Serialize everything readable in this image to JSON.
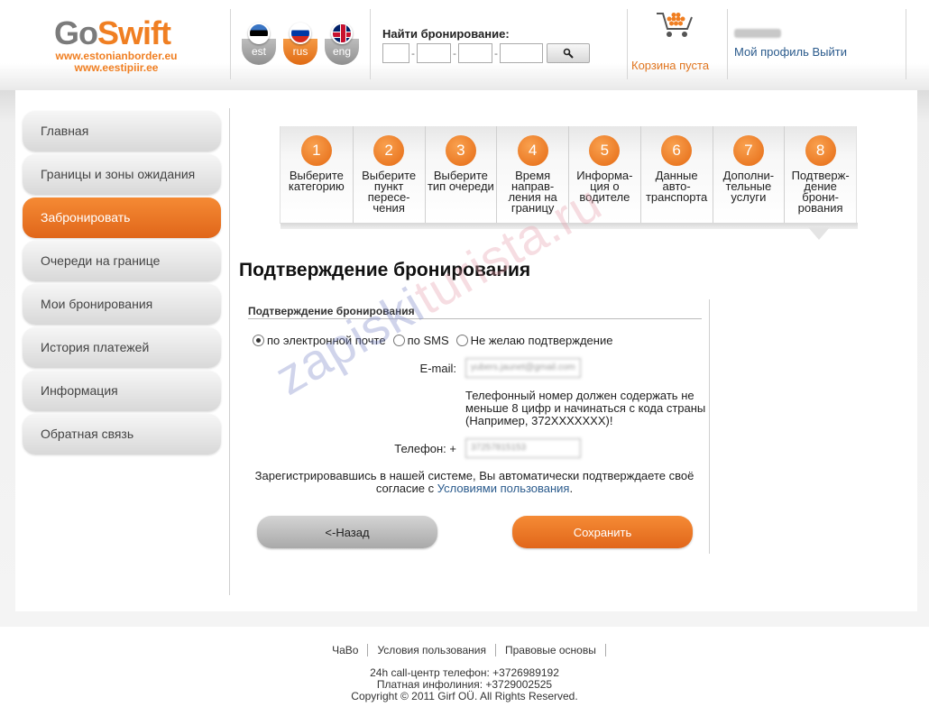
{
  "header": {
    "logo": {
      "part1": "Go",
      "part2": "Swift",
      "url1": "www.estonianborder.eu",
      "url2": "www.eestipiir.ee"
    },
    "languages": [
      {
        "code": "est",
        "active": false
      },
      {
        "code": "rus",
        "active": true
      },
      {
        "code": "eng",
        "active": false
      }
    ],
    "find_label": "Найти бронирование:",
    "find_separator": "-",
    "cart_text": "Корзина пуста",
    "profile_links": "Мой профиль Выйти"
  },
  "sidebar": {
    "items": [
      {
        "label": "Главная",
        "active": false
      },
      {
        "label": "Границы и зоны ожидания",
        "active": false
      },
      {
        "label": "Забронировать",
        "active": true
      },
      {
        "label": "Очереди на границе",
        "active": false
      },
      {
        "label": "Мои бронирования",
        "active": false
      },
      {
        "label": "История платежей",
        "active": false
      },
      {
        "label": "Информация",
        "active": false
      },
      {
        "label": "Обратная связь",
        "active": false
      }
    ]
  },
  "steps": [
    {
      "num": "1",
      "label": "Выберите категорию"
    },
    {
      "num": "2",
      "label": "Выберите пункт пересе-чения"
    },
    {
      "num": "3",
      "label": "Выберите тип очереди"
    },
    {
      "num": "4",
      "label": "Время направ-ления на границу"
    },
    {
      "num": "5",
      "label": "Информа-ция о водителе"
    },
    {
      "num": "6",
      "label": "Данные авто-транспорта"
    },
    {
      "num": "7",
      "label": "Дополни-тельные услуги"
    },
    {
      "num": "8",
      "label": "Подтверж-дение брони-рования"
    }
  ],
  "main": {
    "title": "Подтверждение бронирования",
    "legend": "Подтверждение бронирования",
    "radios": [
      {
        "label": "по электронной почте",
        "checked": true
      },
      {
        "label": "по SMS",
        "checked": false
      },
      {
        "label": "Не желаю подтверждение",
        "checked": false
      }
    ],
    "email_label": "E-mail:",
    "email_value": "yubers.jaunet@gmail.com",
    "hint": "Телефонный номер должен содержать не меньше 8 цифр и начинаться с кода страны (Например, 372XXXXXXX)!",
    "phone_label": "Телефон: +",
    "phone_value": "37257815153",
    "consent_text": "Зарегистрировавшись в нашей системе, Вы автоматически подтверждаете своё согласие с ",
    "consent_link": "Условиями пользования",
    "consent_end": ".",
    "back_label": "<-Назад",
    "save_label": "Сохранить"
  },
  "watermark": {
    "part1": "zapiski",
    "part2": "turista.ru"
  },
  "footer": {
    "links": [
      "ЧаВо",
      "Условия пользования",
      "Правовые основы"
    ],
    "callcenter": "24h call-центр телефон: +3726989192",
    "infoline": "Платная инфолиния: +3729002525",
    "copyright": "Copyright © 2011 Girf OÜ. All Rights Reserved."
  },
  "colors": {
    "accent": "#f07f22",
    "link": "#2a5a8c"
  }
}
